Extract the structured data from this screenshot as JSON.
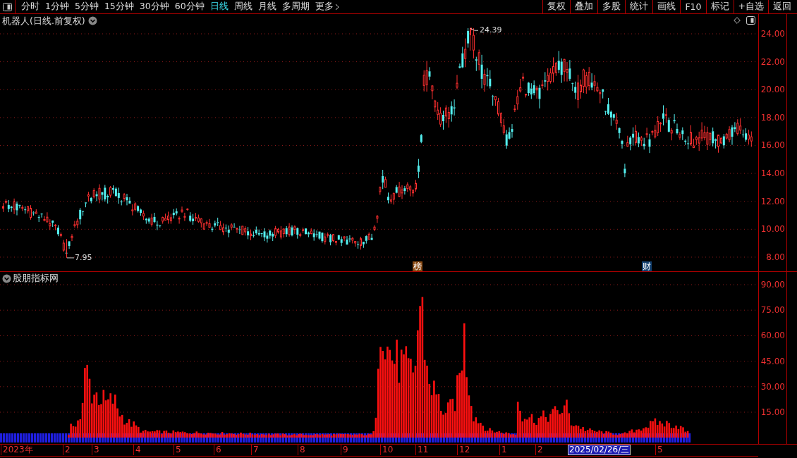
{
  "toolbar": {
    "periods": [
      {
        "label": "分时",
        "selected": false
      },
      {
        "label": "1分钟",
        "selected": false
      },
      {
        "label": "5分钟",
        "selected": false
      },
      {
        "label": "15分钟",
        "selected": false
      },
      {
        "label": "30分钟",
        "selected": false
      },
      {
        "label": "60分钟",
        "selected": false
      },
      {
        "label": "日线",
        "selected": true
      },
      {
        "label": "周线",
        "selected": false
      },
      {
        "label": "月线",
        "selected": false
      },
      {
        "label": "多周期",
        "selected": false
      },
      {
        "label": "更多",
        "selected": false
      }
    ],
    "buttons": [
      "复权",
      "叠加",
      "多股",
      "统计",
      "画线",
      "F10",
      "标记",
      "+自选",
      "返回"
    ]
  },
  "price_panel": {
    "title": "机器人(日线.前复权)",
    "high_label": "24.39",
    "low_label": "7.95",
    "axis_labels": [
      "24.00",
      "22.00",
      "20.00",
      "18.00",
      "16.00",
      "14.00",
      "12.00",
      "10.00",
      "8.00"
    ],
    "event_markers": [
      {
        "label": "榜",
        "color": "#8a4a12"
      },
      {
        "label": "财",
        "color": "#123f6e"
      }
    ]
  },
  "indicator_panel": {
    "title": "股朋指标网",
    "axis_labels": [
      "90.00",
      "75.00",
      "60.00",
      "45.00",
      "30.00",
      "15.00"
    ]
  },
  "date_axis": [
    {
      "label": "2023年",
      "selected": false
    },
    {
      "label": "2",
      "selected": false
    },
    {
      "label": "3",
      "selected": false
    },
    {
      "label": "4",
      "selected": false
    },
    {
      "label": "5",
      "selected": false
    },
    {
      "label": "6",
      "selected": false
    },
    {
      "label": "7",
      "selected": false
    },
    {
      "label": "8",
      "selected": false
    },
    {
      "label": "9",
      "selected": false
    },
    {
      "label": "10",
      "selected": false
    },
    {
      "label": "11",
      "selected": false
    },
    {
      "label": "12",
      "selected": false
    },
    {
      "label": "1",
      "selected": false
    },
    {
      "label": "2",
      "selected": false
    },
    {
      "label": "2025/02/26/三",
      "selected": true
    },
    {
      "label": "5",
      "selected": false
    }
  ]
}
